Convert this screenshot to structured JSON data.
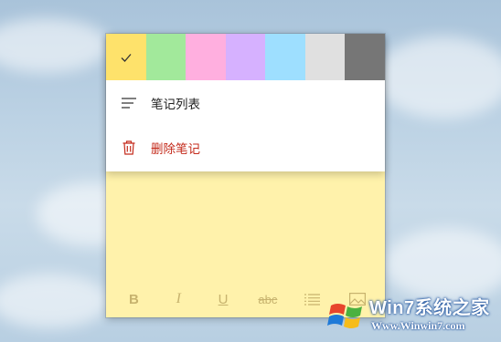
{
  "menu": {
    "colors": [
      {
        "name": "yellow",
        "hex": "#fee26b",
        "selected": true
      },
      {
        "name": "green",
        "hex": "#a2e99b"
      },
      {
        "name": "pink",
        "hex": "#ffafdf"
      },
      {
        "name": "purple",
        "hex": "#d6b1ff"
      },
      {
        "name": "blue",
        "hex": "#9edfff"
      },
      {
        "name": "gray",
        "hex": "#e0e0e0"
      },
      {
        "name": "charcoal",
        "hex": "#767676"
      }
    ],
    "notes_list_label": "笔记列表",
    "delete_label": "删除笔记"
  },
  "note": {
    "background": "#fff2ab"
  },
  "toolbar": {
    "bold": "B",
    "italic": "I",
    "underline": "U",
    "strikethrough": "abc",
    "icons": [
      "bold-icon",
      "italic-icon",
      "underline-icon",
      "strikethrough-icon",
      "bullet-list-icon",
      "image-icon"
    ]
  },
  "watermark": {
    "title": "Win7系统之家",
    "url": "Www.Winwin7.com"
  }
}
